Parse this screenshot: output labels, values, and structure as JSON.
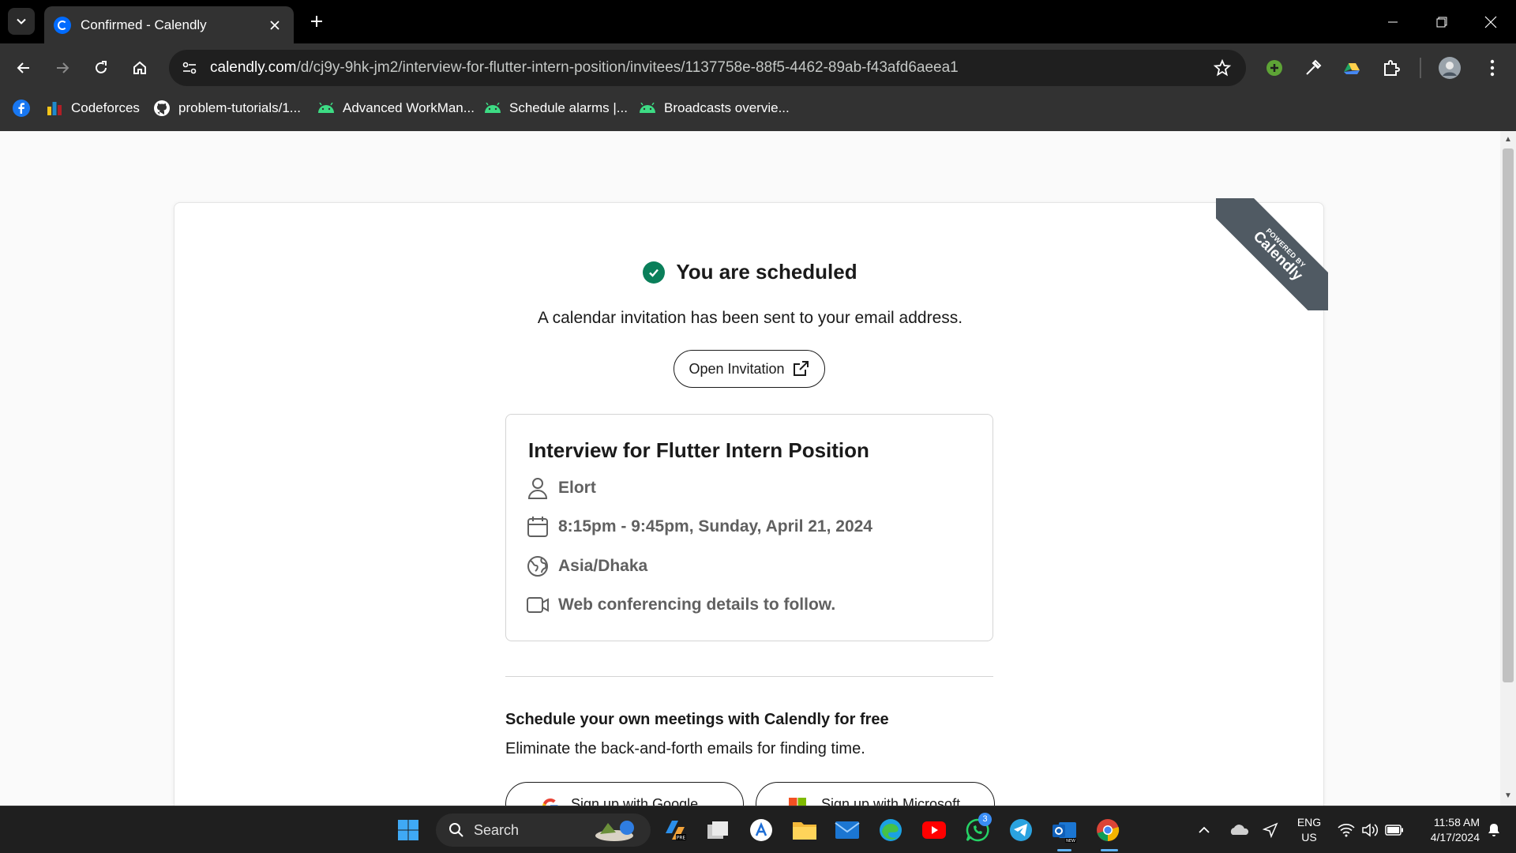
{
  "browser": {
    "tab_title": "Confirmed - Calendly",
    "url_host": "calendly.com",
    "url_path": "/d/cj9y-9hk-jm2/interview-for-flutter-intern-position/invitees/1137758e-88f5-4462-89ab-f43afd6aeea1",
    "bookmarks": [
      {
        "label": "Codeforces",
        "icon": "codeforces-icon"
      },
      {
        "label": "problem-tutorials/1...",
        "icon": "github-icon"
      },
      {
        "label": "Advanced WorkMan...",
        "icon": "android-icon"
      },
      {
        "label": "Schedule alarms |...",
        "icon": "android-icon"
      },
      {
        "label": "Broadcasts overvie...",
        "icon": "android-icon"
      }
    ]
  },
  "page": {
    "ribbon": {
      "powered_by": "POWERED BY",
      "brand": "Calendly"
    },
    "heading": "You are scheduled",
    "subtitle": "A calendar invitation has been sent to your email address.",
    "open_invitation": "Open Invitation",
    "event": {
      "title": "Interview for Flutter Intern Position",
      "host": "Elort",
      "time": "8:15pm - 9:45pm, Sunday, April 21, 2024",
      "timezone": "Asia/Dhaka",
      "location": "Web conferencing details to follow."
    },
    "promo": {
      "title": "Schedule your own meetings with Calendly for free",
      "subtitle": "Eliminate the back-and-forth emails for finding time.",
      "google": "Sign up with Google",
      "microsoft": "Sign up with Microsoft"
    }
  },
  "taskbar": {
    "search": "Search",
    "whatsapp_badge": "3",
    "lang": "ENG",
    "region": "US",
    "time": "11:58 AM",
    "date": "4/17/2024"
  },
  "colors": {
    "success": "#0a7f5a",
    "calendly_blue": "#006bff",
    "ribbon": "#505a63"
  }
}
